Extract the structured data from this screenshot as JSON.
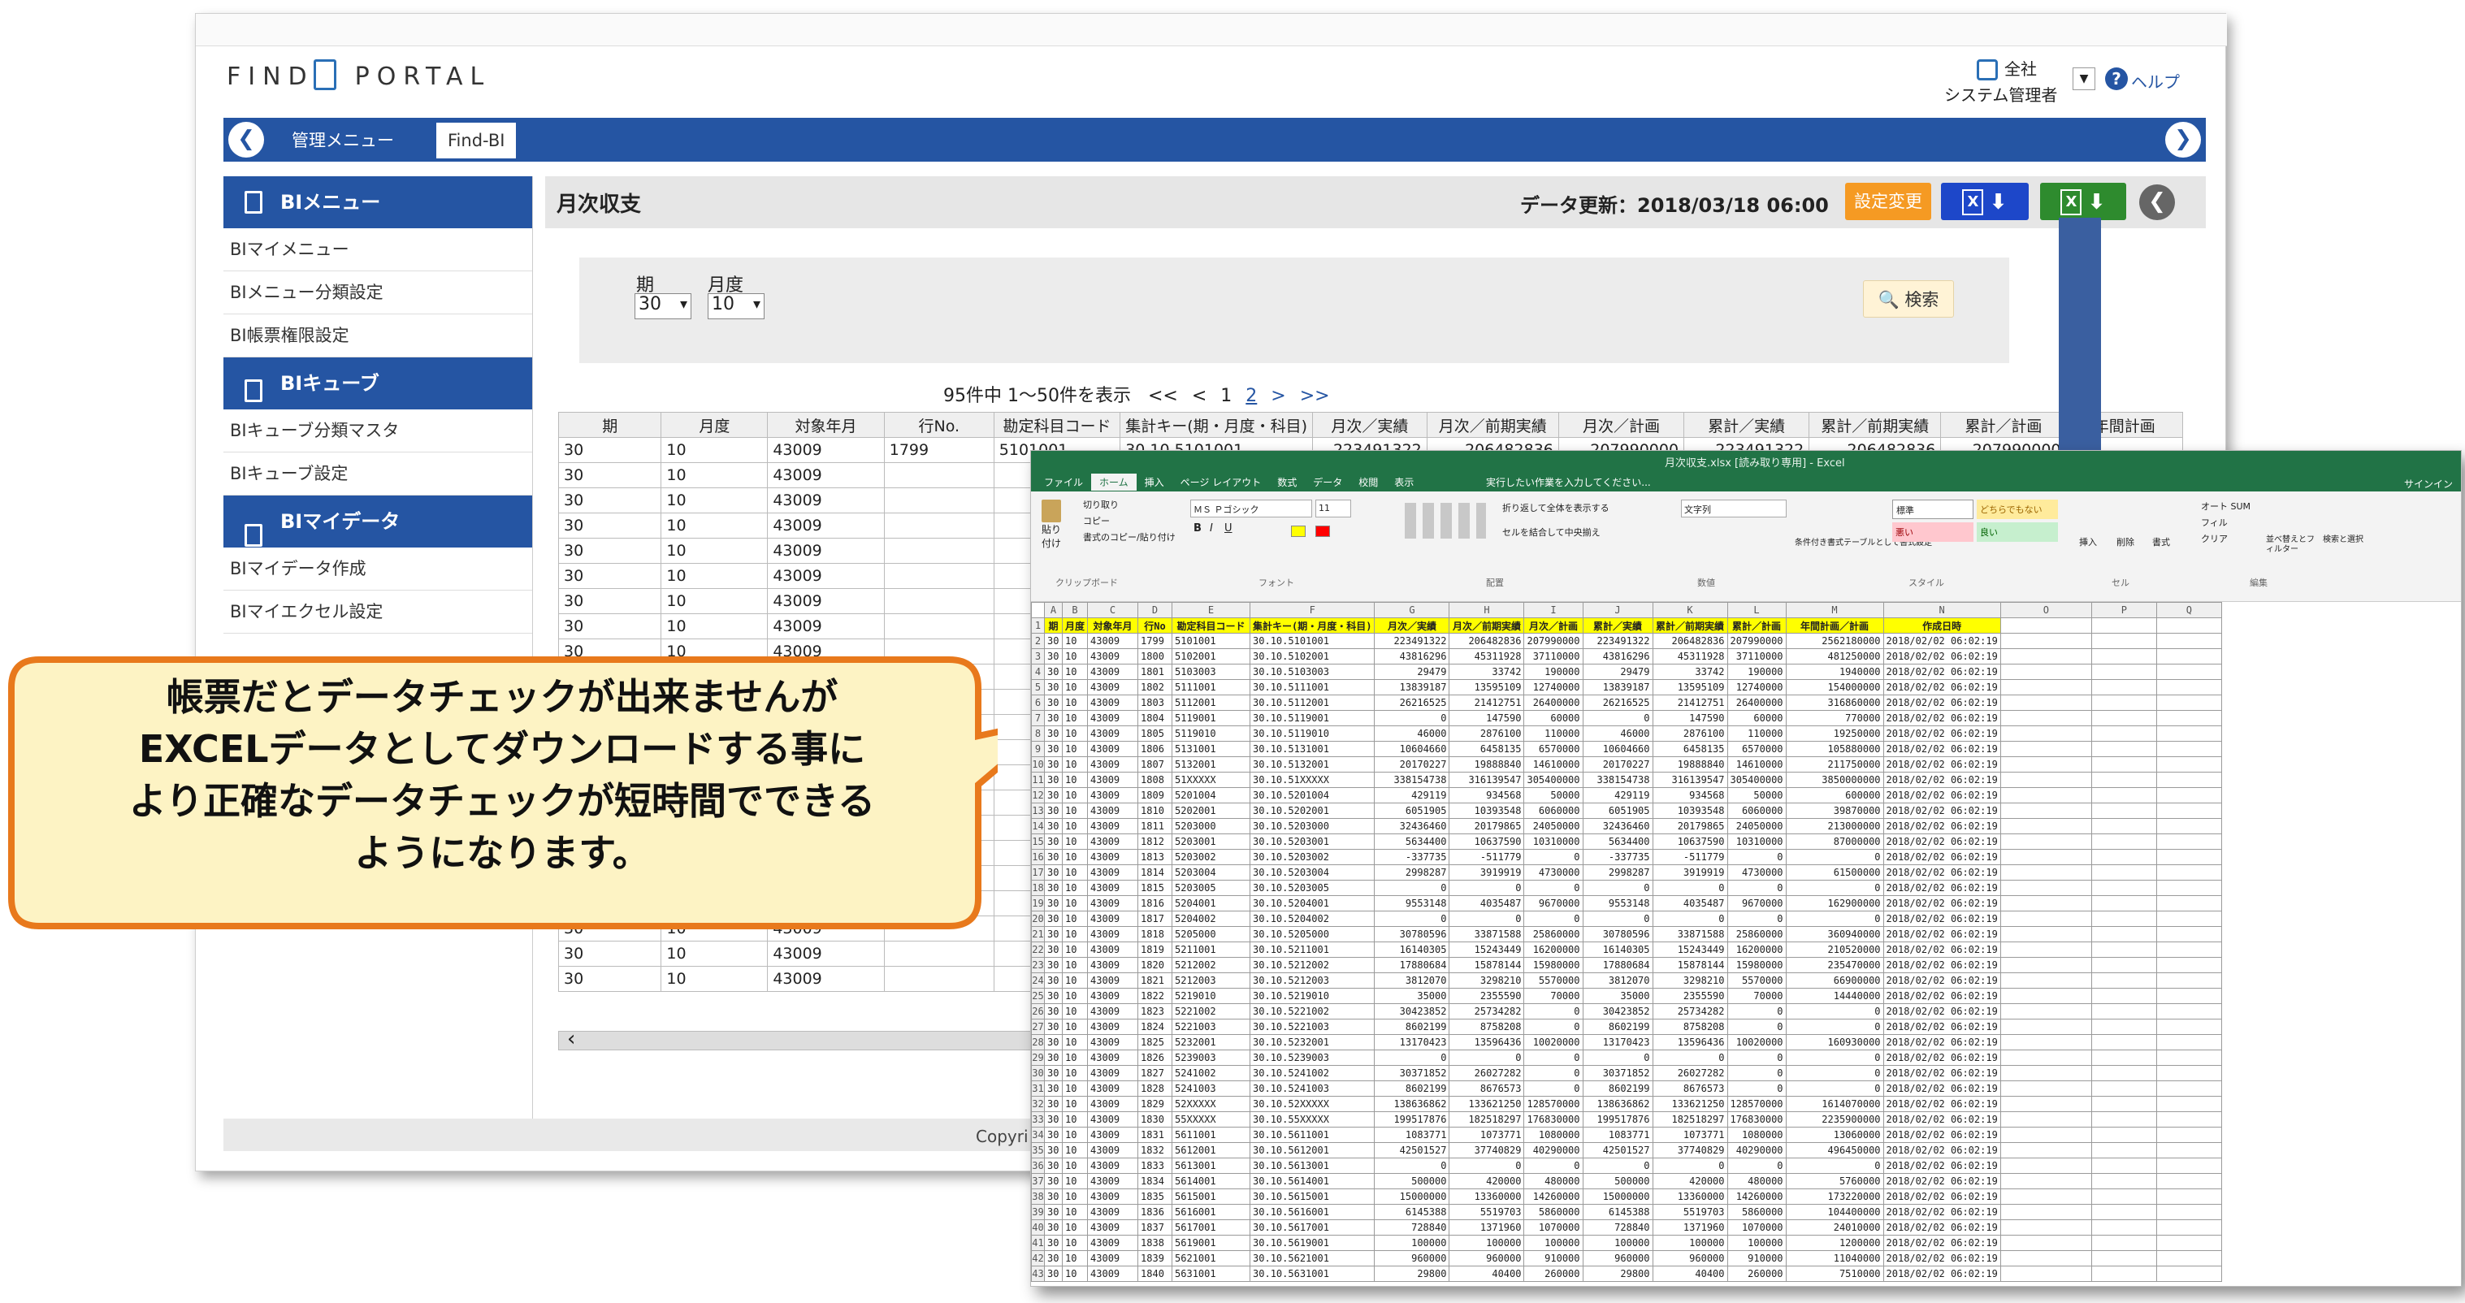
{
  "portal": {
    "logo_left": "FIND",
    "logo_right": "PORTAL",
    "user_org": "全社",
    "user_name": "システム管理者",
    "help": "ヘルプ",
    "footer": "Copyri"
  },
  "nav": {
    "tabs": [
      "管理メニュー",
      "Find-BI"
    ]
  },
  "sidebar": [
    {
      "header": "BIメニュー",
      "items": [
        "BIマイメニュー",
        "BIメニュー分類設定",
        "BI帳票権限設定"
      ]
    },
    {
      "header": "BIキューブ",
      "items": [
        "BIキューブ分類マスタ",
        "BIキューブ設定"
      ]
    },
    {
      "header": "BIマイデータ",
      "items": [
        "BIマイデータ作成",
        "BIマイエクセル設定"
      ]
    }
  ],
  "report": {
    "title": "月次収支",
    "update_label": "データ更新：2018/03/18 06:00",
    "settings_button": "設定変更"
  },
  "filters": {
    "period_label": "期",
    "period_value": "30",
    "month_label": "月度",
    "month_value": "10",
    "search_button": "検索"
  },
  "pagination": {
    "summary": "95件中 1〜50件を表示",
    "first": "<<",
    "prev": "<",
    "page1": "1",
    "page2": "2",
    "next": ">",
    "last": ">>"
  },
  "grid": {
    "columns": [
      "期",
      "月度",
      "対象年月",
      "行No.",
      "勘定科目コード",
      "集計キー(期・月度・科目)",
      "月次／実績",
      "月次／前期実績",
      "月次／計画",
      "累計／実績",
      "累計／前期実績",
      "累計／計画",
      "年間計画"
    ],
    "first_row": [
      "30",
      "10",
      "43009",
      "1799",
      "5101001",
      "30.10.5101001",
      "223491322",
      "206482836",
      "207990000",
      "223491322",
      "206482836",
      "207990000"
    ],
    "rows": [
      [
        "30",
        "10",
        "43009"
      ],
      [
        "30",
        "10",
        "43009"
      ],
      [
        "30",
        "10",
        "43009"
      ],
      [
        "30",
        "10",
        "43009"
      ],
      [
        "30",
        "10",
        "43009"
      ],
      [
        "30",
        "10",
        "43009"
      ],
      [
        "30",
        "10",
        "43009"
      ],
      [
        "30",
        "10",
        "43009"
      ]
    ],
    "bottom_rows": [
      [
        "30",
        "10",
        "43009"
      ],
      [
        "30",
        "10",
        "43009"
      ],
      [
        "30",
        "10",
        "43009"
      ],
      [
        "30",
        "10",
        "43009"
      ]
    ]
  },
  "excel": {
    "title": "月次収支.xlsx [読み取り専用] - Excel",
    "signin": "サインイン",
    "tabs": [
      "ファイル",
      "ホーム",
      "挿入",
      "ページ レイアウト",
      "数式",
      "データ",
      "校閲",
      "表示"
    ],
    "tell_me": "実行したい作業を入力してください...",
    "font": "ＭＳ Ｐゴシック",
    "font_size": "11",
    "number_format": "文字列",
    "style_normal": "標準",
    "style_neutral": "どちらでもない",
    "style_bad": "悪い",
    "style_good": "良い",
    "paste": "貼り付け",
    "cut": "切り取り",
    "copy": "コピー",
    "format_painter": "書式のコピー/貼り付け",
    "wrap": "折り返して全体を表示する",
    "merge": "セルを結合して中央揃え",
    "cond_format": "条件付き書式",
    "table_format": "テーブルとして書式設定",
    "insert": "挿入",
    "delete": "削除",
    "format": "書式",
    "autosum": "オート SUM",
    "fill": "フィル",
    "clear": "クリア",
    "sort": "並べ替えとフィルター",
    "find": "検索と選択",
    "groups": [
      "クリップボード",
      "フォント",
      "配置",
      "数値",
      "スタイル",
      "セル",
      "編集"
    ],
    "col_letters": [
      "A",
      "B",
      "C",
      "D",
      "E",
      "F",
      "G",
      "H",
      "I",
      "J",
      "K",
      "L",
      "M",
      "N",
      "O",
      "P",
      "Q"
    ],
    "header": [
      "期",
      "月度",
      "対象年月",
      "行No",
      "勘定科目コード",
      "集計キー(期・月度・科目)",
      "月次／実績",
      "月次／前期実績",
      "月次／計画",
      "累計／実績",
      "累計／前期実績",
      "累計／計画",
      "年間計画／計画",
      "作成日時"
    ],
    "rows": [
      [
        "1799",
        "5101001",
        "30.10.5101001",
        "223491322",
        "206482836",
        "207990000",
        "223491322",
        "206482836",
        "207990000",
        "2562180000"
      ],
      [
        "1800",
        "5102001",
        "30.10.5102001",
        "43816296",
        "45311928",
        "37110000",
        "43816296",
        "45311928",
        "37110000",
        "481250000"
      ],
      [
        "1801",
        "5103003",
        "30.10.5103003",
        "29479",
        "33742",
        "190000",
        "29479",
        "33742",
        "190000",
        "1940000"
      ],
      [
        "1802",
        "5111001",
        "30.10.5111001",
        "13839187",
        "13595109",
        "12740000",
        "13839187",
        "13595109",
        "12740000",
        "154000000"
      ],
      [
        "1803",
        "5112001",
        "30.10.5112001",
        "26216525",
        "21412751",
        "26400000",
        "26216525",
        "21412751",
        "26400000",
        "316860000"
      ],
      [
        "1804",
        "5119001",
        "30.10.5119001",
        "0",
        "147590",
        "60000",
        "0",
        "147590",
        "60000",
        "770000"
      ],
      [
        "1805",
        "5119010",
        "30.10.5119010",
        "46000",
        "2876100",
        "110000",
        "46000",
        "2876100",
        "110000",
        "19250000"
      ],
      [
        "1806",
        "5131001",
        "30.10.5131001",
        "10604660",
        "6458135",
        "6570000",
        "10604660",
        "6458135",
        "6570000",
        "105880000"
      ],
      [
        "1807",
        "5132001",
        "30.10.5132001",
        "20170227",
        "19888840",
        "14610000",
        "20170227",
        "19888840",
        "14610000",
        "211750000"
      ],
      [
        "1808",
        "51XXXXX",
        "30.10.51XXXXX",
        "338154738",
        "316139547",
        "305400000",
        "338154738",
        "316139547",
        "305400000",
        "3850000000"
      ],
      [
        "1809",
        "5201004",
        "30.10.5201004",
        "429119",
        "934568",
        "50000",
        "429119",
        "934568",
        "50000",
        "600000"
      ],
      [
        "1810",
        "5202001",
        "30.10.5202001",
        "6051905",
        "10393548",
        "6060000",
        "6051905",
        "10393548",
        "6060000",
        "39870000"
      ],
      [
        "1811",
        "5203000",
        "30.10.5203000",
        "32436460",
        "20179865",
        "24050000",
        "32436460",
        "20179865",
        "24050000",
        "213000000"
      ],
      [
        "1812",
        "5203001",
        "30.10.5203001",
        "5634400",
        "10637590",
        "10310000",
        "5634400",
        "10637590",
        "10310000",
        "87000000"
      ],
      [
        "1813",
        "5203002",
        "30.10.5203002",
        "-337735",
        "-511779",
        "0",
        "-337735",
        "-511779",
        "0",
        "0"
      ],
      [
        "1814",
        "5203004",
        "30.10.5203004",
        "2998287",
        "3919919",
        "4730000",
        "2998287",
        "3919919",
        "4730000",
        "61500000"
      ],
      [
        "1815",
        "5203005",
        "30.10.5203005",
        "0",
        "0",
        "0",
        "0",
        "0",
        "0",
        "0"
      ],
      [
        "1816",
        "5204001",
        "30.10.5204001",
        "9553148",
        "4035487",
        "9670000",
        "9553148",
        "4035487",
        "9670000",
        "162900000"
      ],
      [
        "1817",
        "5204002",
        "30.10.5204002",
        "0",
        "0",
        "0",
        "0",
        "0",
        "0",
        "0"
      ],
      [
        "1818",
        "5205000",
        "30.10.5205000",
        "30780596",
        "33871588",
        "25860000",
        "30780596",
        "33871588",
        "25860000",
        "360940000"
      ],
      [
        "1819",
        "5211001",
        "30.10.5211001",
        "16140305",
        "15243449",
        "16200000",
        "16140305",
        "15243449",
        "16200000",
        "210520000"
      ],
      [
        "1820",
        "5212002",
        "30.10.5212002",
        "17880684",
        "15878144",
        "15980000",
        "17880684",
        "15878144",
        "15980000",
        "235470000"
      ],
      [
        "1821",
        "5212003",
        "30.10.5212003",
        "3812070",
        "3298210",
        "5570000",
        "3812070",
        "3298210",
        "5570000",
        "66900000"
      ],
      [
        "1822",
        "5219010",
        "30.10.5219010",
        "35000",
        "2355590",
        "70000",
        "35000",
        "2355590",
        "70000",
        "14440000"
      ],
      [
        "1823",
        "5221002",
        "30.10.5221002",
        "30423852",
        "25734282",
        "0",
        "30423852",
        "25734282",
        "0",
        "0"
      ],
      [
        "1824",
        "5221003",
        "30.10.5221003",
        "8602199",
        "8758208",
        "0",
        "8602199",
        "8758208",
        "0",
        "0"
      ],
      [
        "1825",
        "5232001",
        "30.10.5232001",
        "13170423",
        "13596436",
        "10020000",
        "13170423",
        "13596436",
        "10020000",
        "160930000"
      ],
      [
        "1826",
        "5239003",
        "30.10.5239003",
        "0",
        "0",
        "0",
        "0",
        "0",
        "0",
        "0"
      ],
      [
        "1827",
        "5241002",
        "30.10.5241002",
        "30371852",
        "26027282",
        "0",
        "30371852",
        "26027282",
        "0",
        "0"
      ],
      [
        "1828",
        "5241003",
        "30.10.5241003",
        "8602199",
        "8676573",
        "0",
        "8602199",
        "8676573",
        "0",
        "0"
      ],
      [
        "1829",
        "52XXXXX",
        "30.10.52XXXXX",
        "138636862",
        "133621250",
        "128570000",
        "138636862",
        "133621250",
        "128570000",
        "1614070000"
      ],
      [
        "1830",
        "55XXXXX",
        "30.10.55XXXXX",
        "199517876",
        "182518297",
        "176830000",
        "199517876",
        "182518297",
        "176830000",
        "2235900000"
      ],
      [
        "1831",
        "5611001",
        "30.10.5611001",
        "1083771",
        "1073771",
        "1080000",
        "1083771",
        "1073771",
        "1080000",
        "13060000"
      ],
      [
        "1832",
        "5612001",
        "30.10.5612001",
        "42501527",
        "37740829",
        "40290000",
        "42501527",
        "37740829",
        "40290000",
        "496450000"
      ],
      [
        "1833",
        "5613001",
        "30.10.5613001",
        "0",
        "0",
        "0",
        "0",
        "0",
        "0",
        "0"
      ],
      [
        "1834",
        "5614001",
        "30.10.5614001",
        "500000",
        "420000",
        "480000",
        "500000",
        "420000",
        "480000",
        "5760000"
      ],
      [
        "1835",
        "5615001",
        "30.10.5615001",
        "15000000",
        "13360000",
        "14260000",
        "15000000",
        "13360000",
        "14260000",
        "173220000"
      ],
      [
        "1836",
        "5616001",
        "30.10.5616001",
        "6145388",
        "5519703",
        "5860000",
        "6145388",
        "5519703",
        "5860000",
        "104400000"
      ],
      [
        "1837",
        "5617001",
        "30.10.5617001",
        "728840",
        "1371960",
        "1070000",
        "728840",
        "1371960",
        "1070000",
        "24010000"
      ],
      [
        "1838",
        "5619001",
        "30.10.5619001",
        "100000",
        "100000",
        "100000",
        "100000",
        "100000",
        "100000",
        "1200000"
      ],
      [
        "1839",
        "5621001",
        "30.10.5621001",
        "960000",
        "960000",
        "910000",
        "960000",
        "960000",
        "910000",
        "11040000"
      ],
      [
        "1840",
        "5631001",
        "30.10.5631001",
        "29800",
        "40400",
        "260000",
        "29800",
        "40400",
        "260000",
        "7510000"
      ]
    ],
    "constants": {
      "period": "30",
      "month": "10",
      "ym": "43009",
      "created": "2018/02/02  06:02:19"
    }
  },
  "callout": {
    "lines": [
      "帳票だとデータチェックが出来ませんが",
      "EXCELデータとしてダウンロードする事に",
      "より正確なデータチェックが短時間でできる",
      "ようになります。"
    ]
  },
  "colors": {
    "nav": "#2555a3",
    "settings": "#f59a23",
    "excel_green": "#217346",
    "callout_fill": "#fdf3c4",
    "callout_border": "#e8791c",
    "arrow": "#3a5fa0"
  }
}
